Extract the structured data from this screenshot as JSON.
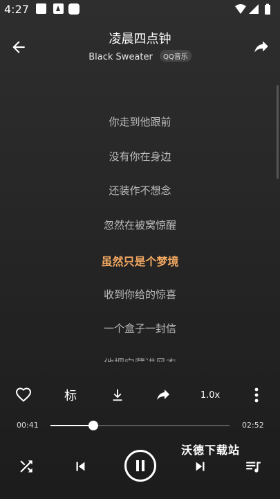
{
  "status_bar": {
    "time": "4:27"
  },
  "header": {
    "title": "凌晨四点钟",
    "artist": "Black Sweater",
    "source_tag": "QQ音乐"
  },
  "lyrics": [
    {
      "text": "你走到他跟前",
      "active": false
    },
    {
      "text": "没有你在身边",
      "active": false
    },
    {
      "text": "还装作不想念",
      "active": false
    },
    {
      "text": "忽然在被窝惊醒",
      "active": false
    },
    {
      "text": "虽然只是个梦境",
      "active": true
    },
    {
      "text": "收到你给的惊喜",
      "active": false
    },
    {
      "text": "一个盒子一封信",
      "active": false
    },
    {
      "text": "他把它藏进风衣",
      "active": false
    }
  ],
  "actions": {
    "mark_label": "标",
    "speed_label": "1.0x"
  },
  "progress": {
    "current": "00:41",
    "duration": "02:52",
    "fraction": 0.24
  },
  "watermark": "沃德下载站",
  "colors": {
    "accent_lyric": "#f2a861",
    "background": "#262626"
  },
  "icons": [
    "back-arrow-icon",
    "share-icon",
    "heart-icon",
    "download-icon",
    "more-vert-icon",
    "shuffle-icon",
    "skip-previous-icon",
    "pause-icon",
    "skip-next-icon",
    "playlist-icon"
  ]
}
